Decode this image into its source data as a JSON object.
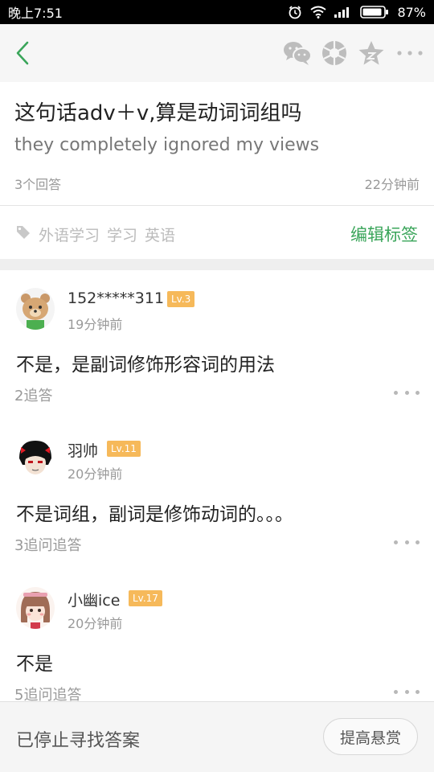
{
  "status_bar": {
    "time": "晚上7:51",
    "battery": "87%",
    "icons": [
      "alarm-icon",
      "wifi-icon",
      "signal-icon",
      "battery-icon"
    ]
  },
  "toolbar": {
    "icons": [
      "back-icon",
      "wechat-icon",
      "moments-icon",
      "star-icon",
      "more-icon"
    ]
  },
  "question": {
    "title": "这句话adv＋v,算是动词词组吗",
    "description": "they completely ignored my views",
    "answer_count": "3个回答",
    "time": "22分钟前"
  },
  "tags": {
    "items": [
      "外语学习",
      "学习",
      "英语"
    ],
    "edit_label": "编辑标签"
  },
  "answers": [
    {
      "user": "152*****311",
      "level": "Lv.3",
      "time": "19分钟前",
      "content": "不是，是副词修饰形容词的用法",
      "footer": "2追答"
    },
    {
      "user": "羽帅",
      "level": "Lv.11",
      "time": "20分钟前",
      "content": "不是词组，副词是修饰动词的。。。",
      "footer": "3追问追答"
    },
    {
      "user": "小幽ice",
      "level": "Lv.17",
      "time": "20分钟前",
      "content": "不是",
      "footer": "5追问追答"
    }
  ],
  "bottom": {
    "status": "已停止寻找答案",
    "raise_button": "提高悬赏"
  },
  "colors": {
    "accent_green": "#3aa55a",
    "level_badge": "#f6b95a"
  }
}
